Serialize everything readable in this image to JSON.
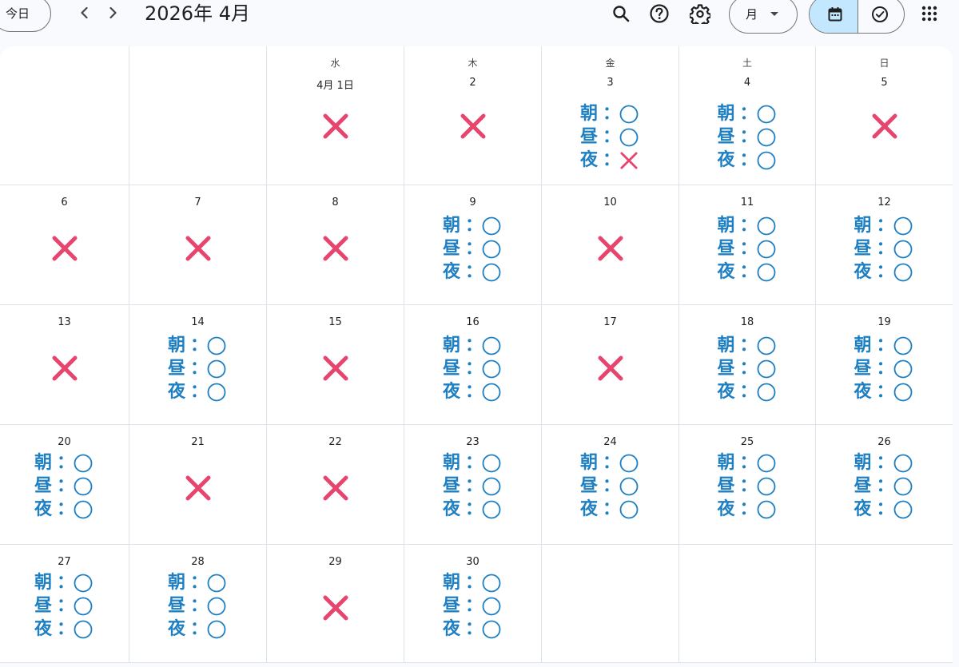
{
  "toolbar": {
    "today_label": "今日",
    "prev_icon": "chevron-left-icon",
    "next_icon": "chevron-right-icon",
    "month_title": "2026年 4月",
    "search_icon": "search-icon",
    "help_icon": "help-icon",
    "settings_icon": "gear-icon",
    "view_label": "月",
    "calendar_view_icon": "calendar-icon",
    "tasks_view_icon": "tasks-check-icon",
    "apps_icon": "apps-grid-icon"
  },
  "colors": {
    "accent_blue": "#1e7fc2",
    "cross_red": "#e8456e",
    "selected_segment": "#c2e7ff",
    "grid_line": "#dde3ea"
  },
  "meal_labels": {
    "morning": "朝",
    "noon": "昼",
    "night": "夜",
    "separator": "："
  },
  "weekdays": [
    "",
    "",
    "水",
    "木",
    "金",
    "土",
    "日"
  ],
  "weeks": [
    [
      {
        "label": "",
        "mark": "none"
      },
      {
        "label": "",
        "mark": "none"
      },
      {
        "label": "4月 1日",
        "mark": "x"
      },
      {
        "label": "2",
        "mark": "x"
      },
      {
        "label": "3",
        "mark": "meals",
        "meals": [
          "ok",
          "ok",
          "x"
        ]
      },
      {
        "label": "4",
        "mark": "meals",
        "meals": [
          "ok",
          "ok",
          "ok"
        ]
      },
      {
        "label": "5",
        "mark": "x"
      }
    ],
    [
      {
        "label": "6",
        "mark": "x"
      },
      {
        "label": "7",
        "mark": "x"
      },
      {
        "label": "8",
        "mark": "x"
      },
      {
        "label": "9",
        "mark": "meals",
        "meals": [
          "ok",
          "ok",
          "ok"
        ]
      },
      {
        "label": "10",
        "mark": "x"
      },
      {
        "label": "11",
        "mark": "meals",
        "meals": [
          "ok",
          "ok",
          "ok"
        ]
      },
      {
        "label": "12",
        "mark": "meals",
        "meals": [
          "ok",
          "ok",
          "ok"
        ]
      }
    ],
    [
      {
        "label": "13",
        "mark": "x"
      },
      {
        "label": "14",
        "mark": "meals",
        "meals": [
          "ok",
          "ok",
          "ok"
        ]
      },
      {
        "label": "15",
        "mark": "x"
      },
      {
        "label": "16",
        "mark": "meals",
        "meals": [
          "ok",
          "ok",
          "ok"
        ]
      },
      {
        "label": "17",
        "mark": "x"
      },
      {
        "label": "18",
        "mark": "meals",
        "meals": [
          "ok",
          "ok",
          "ok"
        ]
      },
      {
        "label": "19",
        "mark": "meals",
        "meals": [
          "ok",
          "ok",
          "ok"
        ]
      }
    ],
    [
      {
        "label": "20",
        "mark": "meals",
        "meals": [
          "ok",
          "ok",
          "ok"
        ]
      },
      {
        "label": "21",
        "mark": "x"
      },
      {
        "label": "22",
        "mark": "x"
      },
      {
        "label": "23",
        "mark": "meals",
        "meals": [
          "ok",
          "ok",
          "ok"
        ]
      },
      {
        "label": "24",
        "mark": "meals",
        "meals": [
          "ok",
          "ok",
          "ok"
        ]
      },
      {
        "label": "25",
        "mark": "meals",
        "meals": [
          "ok",
          "ok",
          "ok"
        ]
      },
      {
        "label": "26",
        "mark": "meals",
        "meals": [
          "ok",
          "ok",
          "ok"
        ]
      }
    ],
    [
      {
        "label": "27",
        "mark": "meals",
        "meals": [
          "ok",
          "ok",
          "ok"
        ]
      },
      {
        "label": "28",
        "mark": "meals",
        "meals": [
          "ok",
          "ok",
          "ok"
        ]
      },
      {
        "label": "29",
        "mark": "x"
      },
      {
        "label": "30",
        "mark": "meals",
        "meals": [
          "ok",
          "ok",
          "ok"
        ]
      },
      {
        "label": "",
        "mark": "none"
      },
      {
        "label": "",
        "mark": "none"
      },
      {
        "label": "",
        "mark": "none"
      }
    ]
  ]
}
